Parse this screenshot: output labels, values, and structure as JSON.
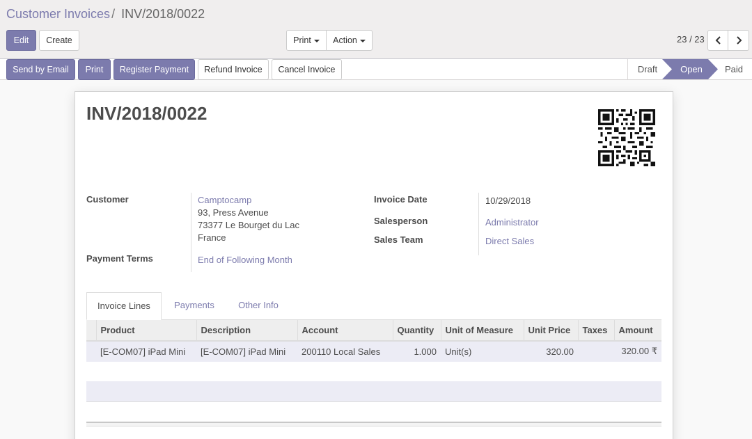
{
  "breadcrumb": {
    "parent": "Customer Invoices",
    "separator": "/",
    "current": "INV/2018/0022"
  },
  "toolbar": {
    "edit_label": "Edit",
    "create_label": "Create",
    "print_label": "Print",
    "action_label": "Action"
  },
  "pager": {
    "value": "23 / 23",
    "prev_icon": "chevron-left-icon",
    "next_icon": "chevron-right-icon"
  },
  "header_buttons": {
    "send_email": "Send by Email",
    "print": "Print",
    "register_payment": "Register Payment",
    "refund_invoice": "Refund Invoice",
    "cancel_invoice": "Cancel Invoice"
  },
  "status": {
    "steps": [
      "Draft",
      "Open",
      "Paid"
    ],
    "active": "Open"
  },
  "invoice": {
    "number": "INV/2018/0022",
    "customer_label": "Customer",
    "customer": {
      "name": "Camptocamp",
      "street": "93, Press Avenue",
      "city": "73377 Le Bourget du Lac",
      "country": "France"
    },
    "payment_terms_label": "Payment Terms",
    "payment_terms": "End of Following Month",
    "invoice_date_label": "Invoice Date",
    "invoice_date": "10/29/2018",
    "salesperson_label": "Salesperson",
    "salesperson": "Administrator",
    "sales_team_label": "Sales Team",
    "sales_team": "Direct Sales"
  },
  "tabs": [
    "Invoice Lines",
    "Payments",
    "Other Info"
  ],
  "lines_table": {
    "columns": [
      "Product",
      "Description",
      "Account",
      "Quantity",
      "Unit of Measure",
      "Unit Price",
      "Taxes",
      "Amount"
    ],
    "rows": [
      {
        "product": "[E-COM07] iPad Mini",
        "description": "[E-COM07] iPad Mini",
        "account": "200110 Local Sales",
        "quantity": "1.000",
        "uom": "Unit(s)",
        "unit_price": "320.00",
        "taxes": "",
        "amount": "320.00 ₹"
      }
    ]
  },
  "colors": {
    "accent": "#7c7bad",
    "control_panel_bg": "#f0eeee"
  }
}
